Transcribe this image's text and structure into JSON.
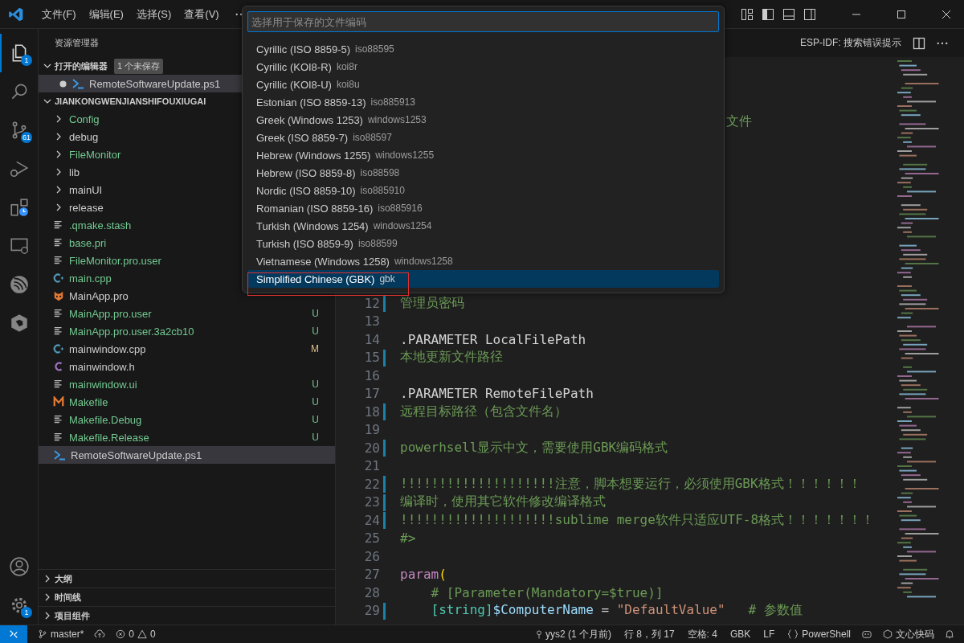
{
  "title_bar": {
    "menus": [
      "文件(F)",
      "编辑(E)",
      "选择(S)",
      "查看(V)"
    ]
  },
  "activity_bar": {
    "items": [
      {
        "selected": true,
        "badge": "1"
      },
      {
        "selected": false
      },
      {
        "selected": false,
        "badge": "61"
      },
      {
        "selected": false
      },
      {
        "selected": false
      },
      {
        "selected": false
      },
      {
        "selected": false
      },
      {
        "selected": false
      }
    ],
    "bottom": [
      {
        "selected": false
      },
      {
        "selected": false,
        "badge": "1"
      }
    ]
  },
  "sidebar": {
    "title": "资源管理器",
    "open_editors": {
      "label": "打开的编辑器",
      "expanded": true,
      "badge": "1 个未保存",
      "items": [
        {
          "name": "RemoteSoftwareUpdate.ps1",
          "dirty": true,
          "selected": true
        }
      ]
    },
    "folder": {
      "label": "JIANKONGWENJIANSHIFOUXIUGAI",
      "expanded": true,
      "items": [
        {
          "kind": "folder",
          "name": "Config",
          "expanded": false,
          "color": "#73c991",
          "selected": false
        },
        {
          "kind": "folder",
          "name": "debug",
          "expanded": false,
          "color": "#cccccc",
          "selected": false
        },
        {
          "kind": "folder",
          "name": "FileMonitor",
          "expanded": false,
          "color": "#73c991",
          "selected": false
        },
        {
          "kind": "folder",
          "name": "lib",
          "expanded": false,
          "color": "#cccccc",
          "selected": false
        },
        {
          "kind": "folder",
          "name": "mainUI",
          "expanded": false,
          "color": "#cccccc",
          "selected": false
        },
        {
          "kind": "folder",
          "name": "release",
          "expanded": false,
          "color": "#cccccc",
          "selected": false
        },
        {
          "kind": "text",
          "name": ".qmake.stash",
          "color": "#73c991",
          "selected": false
        },
        {
          "kind": "text",
          "name": "base.pri",
          "color": "#73c991",
          "selected": false
        },
        {
          "kind": "text",
          "name": "FileMonitor.pro.user",
          "color": "#73c991",
          "selected": false
        },
        {
          "kind": "cpp",
          "name": "main.cpp",
          "color": "#73c991",
          "selected": false
        },
        {
          "kind": "qt",
          "name": "MainApp.pro",
          "color": "#cccccc",
          "selected": false
        },
        {
          "kind": "text",
          "name": "MainApp.pro.user",
          "color": "#73c991",
          "status": "U",
          "selected": false
        },
        {
          "kind": "text",
          "name": "MainApp.pro.user.3a2cb10",
          "color": "#73c991",
          "status": "U",
          "selected": false
        },
        {
          "kind": "cpp",
          "name": "mainwindow.cpp",
          "color": "#cccccc",
          "status": "M",
          "selected": false
        },
        {
          "kind": "header",
          "name": "mainwindow.h",
          "color": "#cccccc",
          "selected": false
        },
        {
          "kind": "text",
          "name": "mainwindow.ui",
          "color": "#73c991",
          "status": "U",
          "selected": false
        },
        {
          "kind": "make",
          "name": "Makefile",
          "color": "#73c991",
          "status": "U",
          "selected": false
        },
        {
          "kind": "text",
          "name": "Makefile.Debug",
          "color": "#73c991",
          "status": "U",
          "selected": false
        },
        {
          "kind": "text",
          "name": "Makefile.Release",
          "color": "#73c991",
          "status": "U",
          "selected": false
        },
        {
          "kind": "script",
          "name": "RemoteSoftwareUpdate.ps1",
          "color": "#cccccc",
          "selected": true
        }
      ]
    },
    "sections": [
      {
        "label": "大纲",
        "expanded": false
      },
      {
        "label": "时间线",
        "expanded": false
      },
      {
        "label": "项目组件",
        "expanded": false
      }
    ]
  },
  "editor": {
    "action": "ESP-IDF: 搜索错误提示",
    "peek_text": "文件",
    "lines": [
      {
        "n": "12",
        "changed": true,
        "segments": [
          {
            "t": "管理员密码",
            "kind": "comment"
          }
        ]
      },
      {
        "n": "13",
        "changed": false
      },
      {
        "n": "14",
        "changed": false,
        "segments": [
          {
            "t": ".PARAMETER LocalFilePath",
            "kind": "plain"
          }
        ]
      },
      {
        "n": "15",
        "changed": true,
        "segments": [
          {
            "t": "本地更新文件路径",
            "kind": "comment"
          }
        ]
      },
      {
        "n": "16",
        "changed": false
      },
      {
        "n": "17",
        "changed": false,
        "segments": [
          {
            "t": ".PARAMETER RemoteFilePath",
            "kind": "plain"
          }
        ]
      },
      {
        "n": "18",
        "changed": true,
        "segments": [
          {
            "t": "远程目标路径（包含文件名）",
            "kind": "comment"
          }
        ]
      },
      {
        "n": "19",
        "changed": false
      },
      {
        "n": "20",
        "changed": true,
        "segments": [
          {
            "t": "powerhsell显示中文，需要使用GBK编码格式",
            "kind": "comment"
          }
        ]
      },
      {
        "n": "21",
        "changed": false
      },
      {
        "n": "22",
        "changed": true,
        "segments": [
          {
            "t": "!!!!!!!!!!!!!!!!!!!!注意，脚本想要运行，必须使用GBK格式！！！！！！",
            "kind": "comment"
          }
        ]
      },
      {
        "n": "23",
        "changed": true,
        "segments": [
          {
            "t": "编译时，使用其它软件修改编译格式",
            "kind": "comment"
          }
        ]
      },
      {
        "n": "24",
        "changed": true,
        "segments": [
          {
            "t": "!!!!!!!!!!!!!!!!!!!!sublime merge软件只适应UTF-8格式！！！！！！！",
            "kind": "comment"
          }
        ]
      },
      {
        "n": "25",
        "changed": false,
        "segments": [
          {
            "t": "#>",
            "kind": "comment"
          }
        ]
      },
      {
        "n": "26",
        "changed": false
      },
      {
        "n": "27",
        "changed": false,
        "segments": [
          {
            "t": "param",
            "kind": "keyword"
          },
          {
            "t": "(",
            "kind": "bracket"
          }
        ]
      },
      {
        "n": "28",
        "changed": false,
        "segments": [
          {
            "t": "    # [Parameter(Mandatory=$true)]",
            "kind": "comment"
          }
        ]
      },
      {
        "n": "29",
        "changed": true,
        "segments": [
          {
            "t": "    [string]",
            "kind": "type"
          },
          {
            "t": "$ComputerName",
            "kind": "variable"
          },
          {
            "t": " = ",
            "kind": "plain"
          },
          {
            "t": "\"DefaultValue\"",
            "kind": "string"
          },
          {
            "t": "   # 参数值",
            "kind": "comment"
          }
        ]
      }
    ]
  },
  "quick_pick": {
    "placeholder": "选择用于保存的文件编码",
    "items": [
      {
        "label": "Cyrillic (ISO 8859-5)",
        "detail": "iso88595",
        "selected": false
      },
      {
        "label": "Cyrillic (KOI8-R)",
        "detail": "koi8r",
        "selected": false
      },
      {
        "label": "Cyrillic (KOI8-U)",
        "detail": "koi8u",
        "selected": false
      },
      {
        "label": "Estonian (ISO 8859-13)",
        "detail": "iso885913",
        "selected": false
      },
      {
        "label": "Greek (Windows 1253)",
        "detail": "windows1253",
        "selected": false
      },
      {
        "label": "Greek (ISO 8859-7)",
        "detail": "iso88597",
        "selected": false
      },
      {
        "label": "Hebrew (Windows 1255)",
        "detail": "windows1255",
        "selected": false
      },
      {
        "label": "Hebrew (ISO 8859-8)",
        "detail": "iso88598",
        "selected": false
      },
      {
        "label": "Nordic (ISO 8859-10)",
        "detail": "iso885910",
        "selected": false
      },
      {
        "label": "Romanian (ISO 8859-16)",
        "detail": "iso885916",
        "selected": false
      },
      {
        "label": "Turkish (Windows 1254)",
        "detail": "windows1254",
        "selected": false
      },
      {
        "label": "Turkish (ISO 8859-9)",
        "detail": "iso88599",
        "selected": false
      },
      {
        "label": "Vietnamese (Windows 1258)",
        "detail": "windows1258",
        "selected": false
      },
      {
        "label": "Simplified Chinese (GBK)",
        "detail": "gbk",
        "selected": true
      }
    ]
  },
  "status_bar": {
    "branch": "master*",
    "errors": "0",
    "warnings": "0",
    "right": [
      {
        "kind": "blame",
        "text": "yys2 (1 个月前)"
      },
      {
        "kind": "text",
        "text": "行 8，列 17"
      },
      {
        "kind": "text",
        "text": "空格: 4"
      },
      {
        "kind": "text",
        "text": "GBK"
      },
      {
        "kind": "text",
        "text": "LF"
      },
      {
        "kind": "language",
        "text": "PowerShell"
      },
      {
        "kind": "copilot"
      },
      {
        "kind": "assistant",
        "text": "文心快码"
      },
      {
        "kind": "bell"
      }
    ]
  }
}
